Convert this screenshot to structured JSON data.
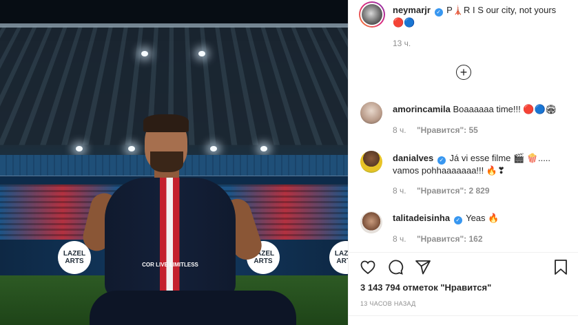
{
  "photo": {
    "board_logos": [
      {
        "line1": "LAZEL",
        "line2": "ARTS"
      },
      {
        "line1": "LAZEL",
        "line2": "ARTS"
      },
      {
        "line1": "LAZEL",
        "line2": "ARTS"
      }
    ],
    "sponsor_text": "COR LIVE LIMITLESS"
  },
  "post": {
    "author": "neymarjr",
    "caption_text": "P🗼R I S our city, not yours 🔴🔵",
    "time": "13 ч.",
    "load_more_icon": "plus-circle-icon"
  },
  "comments": [
    {
      "username": "amorincamila",
      "verified": false,
      "text": "Boaaaaaa time!!! 🔴🔵🏟",
      "time": "8 ч.",
      "likes_label": "\"Нравится\": 55"
    },
    {
      "username": "danialves",
      "verified": true,
      "text": "Já vi esse filme 🎬 🍿..... vamos pohhaaaaaaa!!! 🔥❣",
      "time": "8 ч.",
      "likes_label": "\"Нравится\": 2 829"
    },
    {
      "username": "talitadeisinha",
      "verified": true,
      "text": "Yeas 🔥",
      "time": "8 ч.",
      "likes_label": "\"Нравится\": 162"
    }
  ],
  "actions": {
    "icons": [
      "heart-icon",
      "comment-icon",
      "share-icon",
      "bookmark-icon"
    ]
  },
  "likes_text": "3 143 794 отметок \"Нравится\"",
  "time_ago": "13 ЧАСОВ НАЗАД",
  "colors": {
    "verified": "#3897f0",
    "muted": "#8e8e8e",
    "text": "#262626",
    "psg_red": "#c4212d",
    "psg_navy": "#131f37"
  }
}
